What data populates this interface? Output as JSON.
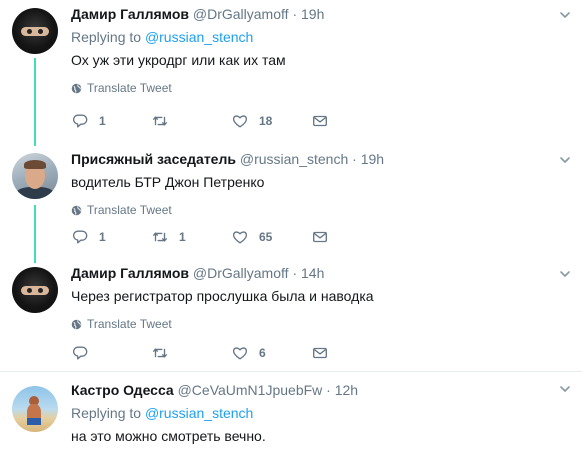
{
  "tweets": [
    {
      "fullname": "Дамир Галлямов",
      "handle": "@DrGallyamoff",
      "dot": "·",
      "time": "19h",
      "replying_label": "Replying to",
      "replying_handle": "@russian_stench",
      "text": "Ох уж эти укродрг или как их там",
      "translate": "Translate Tweet",
      "reply_count": "1",
      "retweet_count": "",
      "like_count": "18"
    },
    {
      "fullname": "Присяжный заседатель",
      "handle": "@russian_stench",
      "dot": "·",
      "time": "19h",
      "text": "водитель БТР Джон Петренко",
      "translate": "Translate Tweet",
      "reply_count": "1",
      "retweet_count": "1",
      "like_count": "65"
    },
    {
      "fullname": "Дамир Галлямов",
      "handle": "@DrGallyamoff",
      "dot": "·",
      "time": "14h",
      "text": "Через регистратор прослушка была и наводка",
      "translate": "Translate Tweet",
      "reply_count": "",
      "retweet_count": "",
      "like_count": "6"
    },
    {
      "fullname": "Кастро Одесса",
      "handle": "@CeVaUmN1JpuebFw",
      "dot": "·",
      "time": "12h",
      "replying_label": "Replying to",
      "replying_handle": "@russian_stench",
      "text": "на это можно смотреть вечно."
    }
  ],
  "colors": {
    "accent": "#1da1f2",
    "thread": "#00d4a3",
    "muted": "#657786"
  },
  "icons": [
    "reply-icon",
    "retweet-icon",
    "like-icon",
    "message-icon",
    "globe-icon",
    "chevron-down-icon"
  ]
}
